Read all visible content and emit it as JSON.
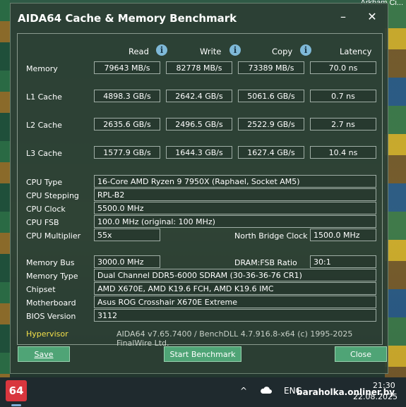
{
  "desktop": {
    "corner_text": "Arkham Ci..."
  },
  "window": {
    "title": "AIDA64 Cache & Memory Benchmark",
    "minimize_glyph": "–",
    "close_glyph": "✕"
  },
  "headers": {
    "read": "Read",
    "write": "Write",
    "copy": "Copy",
    "latency": "Latency",
    "info_glyph": "i"
  },
  "rows": [
    {
      "label": "Memory",
      "read": "79643 MB/s",
      "write": "82778 MB/s",
      "copy": "73389 MB/s",
      "latency": "70.0 ns"
    },
    {
      "label": "L1 Cache",
      "read": "4898.3 GB/s",
      "write": "2642.4 GB/s",
      "copy": "5061.6 GB/s",
      "latency": "0.7 ns"
    },
    {
      "label": "L2 Cache",
      "read": "2635.6 GB/s",
      "write": "2496.5 GB/s",
      "copy": "2522.9 GB/s",
      "latency": "2.7 ns"
    },
    {
      "label": "L3 Cache",
      "read": "1577.9 GB/s",
      "write": "1644.3 GB/s",
      "copy": "1627.4 GB/s",
      "latency": "10.4 ns"
    }
  ],
  "cpu": {
    "type_label": "CPU Type",
    "type": "16-Core AMD Ryzen 9 7950X  (Raphael, Socket AM5)",
    "stepping_label": "CPU Stepping",
    "stepping": "RPL-B2",
    "clock_label": "CPU Clock",
    "clock": "5500.0 MHz",
    "fsb_label": "CPU FSB",
    "fsb": "100.0 MHz  (original: 100 MHz)",
    "multiplier_label": "CPU Multiplier",
    "multiplier": "55x",
    "nb_clock_label": "North Bridge Clock",
    "nb_clock": "1500.0 MHz"
  },
  "memory": {
    "bus_label": "Memory Bus",
    "bus": "3000.0 MHz",
    "ratio_label": "DRAM:FSB Ratio",
    "ratio": "30:1",
    "type_label": "Memory Type",
    "type": "Dual Channel DDR5-6000 SDRAM  (30-36-36-76 CR1)",
    "chipset_label": "Chipset",
    "chipset": "AMD X670E, AMD K19.6 FCH, AMD K19.6 IMC",
    "motherboard_label": "Motherboard",
    "motherboard": "Asus ROG Crosshair X670E Extreme",
    "bios_label": "BIOS Version",
    "bios": "3112"
  },
  "footer": {
    "hypervisor": "Hypervisor",
    "version": "AIDA64 v7.65.7400 / BenchDLL 4.7.916.8-x64  (c) 1995-2025 FinalWire Ltd."
  },
  "buttons": {
    "save": "Save",
    "start": "Start Benchmark",
    "close": "Close"
  },
  "taskbar": {
    "app_label": "64",
    "chevron": "^",
    "lang": "ENG",
    "time": "21:30",
    "date": "22.08.2025",
    "watermark": "baraholka.onliner.by"
  }
}
